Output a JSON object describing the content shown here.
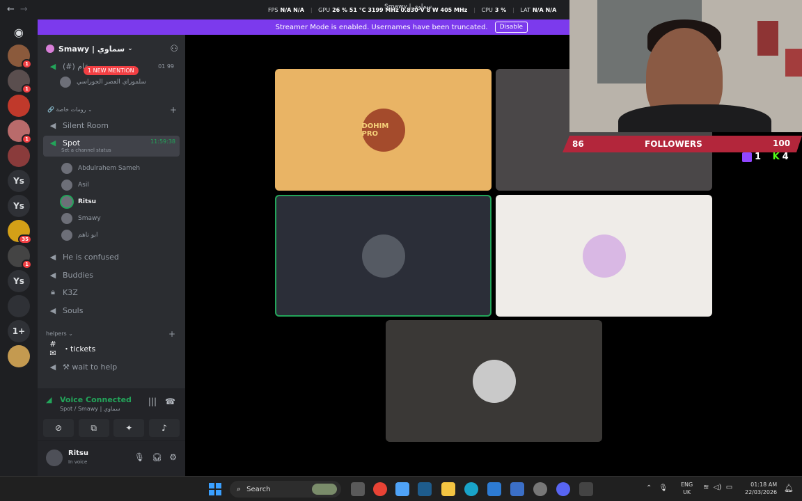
{
  "overlay": {
    "fps_label": "FPS",
    "fps_value": "N/A N/A",
    "gpu_label": "GPU",
    "gpu_value": "26 % 51 °C 3199 MHz 0.830 V 8 W 405 MHz",
    "cpu_label": "CPU",
    "cpu_value": "3 %",
    "lat_label": "LAT",
    "lat_value": "N/A N/A",
    "window_title": "Smawy | سماوي"
  },
  "banner": {
    "text": "Streamer Mode is enabled. Usernames have been truncated.",
    "button": "Disable",
    "color": "#7c3aed"
  },
  "rail": {
    "items": [
      {
        "label": "",
        "badge": "1"
      },
      {
        "label": "",
        "badge": "1"
      },
      {
        "label": "",
        "badge": ""
      },
      {
        "label": "",
        "badge": "1"
      },
      {
        "label": "",
        "badge": ""
      },
      {
        "label": "Ys",
        "badge": ""
      },
      {
        "label": "Ys",
        "badge": ""
      },
      {
        "label": "",
        "badge": "35"
      },
      {
        "label": "",
        "badge": "1"
      },
      {
        "label": "Ys",
        "badge": ""
      },
      {
        "label": "",
        "badge": ""
      },
      {
        "label": "1+",
        "badge": ""
      },
      {
        "label": "",
        "badge": ""
      }
    ]
  },
  "sidebar": {
    "guild_name": "Smawy | سماوي",
    "mention_pill": "1 NEW MENTION",
    "top_channel": "(#) عام",
    "top_counts": "01  99",
    "top_user": "سلموراي العصر الجوراسي",
    "category1": "رومات خاصة",
    "ch_silent": "Silent Room",
    "ch_spot": "Spot",
    "spot_status": "Set a channel status",
    "spot_timer": "11:59:38",
    "voice_users": [
      "Abdulrahem Sameh",
      "Asil",
      "Ritsu",
      "Smawy",
      "ابو ناهم"
    ],
    "ch_confused": "He is confused",
    "ch_buddies": "Buddies",
    "ch_k3z": "K3Z",
    "ch_souls": "Souls",
    "category2": "helpers",
    "ch_tickets": "・tickets",
    "ch_wait": "⚒ wait to help"
  },
  "voice_panel": {
    "status": "Voice Connected",
    "location": "Spot / Smawy | سماوي"
  },
  "user": {
    "name": "Ritsu",
    "status": "In voice"
  },
  "tiles": [
    {
      "label": "DOHIM PRO",
      "bg": "#e9b465"
    },
    {
      "label": "",
      "bg": "#4a4748"
    },
    {
      "label": "",
      "bg": "#2b2e38"
    },
    {
      "label": "",
      "bg": "#efece8"
    },
    {
      "label": "",
      "bg": "#3a3836"
    }
  ],
  "stream_overlay": {
    "followers_count": "86",
    "followers_label": "FOLLOWERS",
    "followers_goal": "100",
    "twitch_count": "1",
    "kick_count": "4",
    "bar_color": "#b3263b"
  },
  "taskbar": {
    "search": "Search",
    "lang_top": "ENG",
    "lang_bottom": "UK",
    "time": "01:18 AM",
    "date": "22/03/2026"
  }
}
